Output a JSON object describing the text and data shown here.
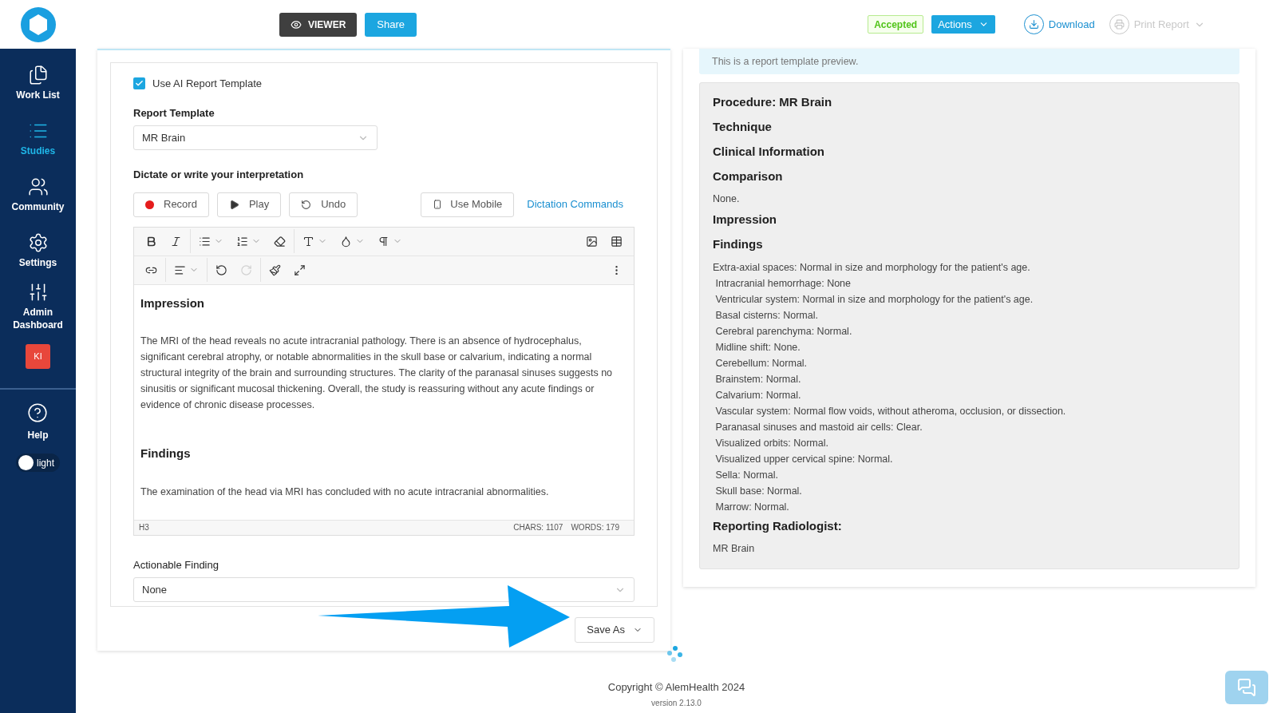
{
  "header": {
    "viewer_button": "VIEWER",
    "share_button": "Share",
    "status_badge": "Accepted",
    "actions_button": "Actions",
    "download": "Download",
    "print_report": {
      "label": "Print Report",
      "disabled": true
    }
  },
  "sidebar": {
    "items": [
      {
        "label": "Work List",
        "selected": false
      },
      {
        "label": "Studies",
        "selected": true
      },
      {
        "label": "Community",
        "selected": false
      },
      {
        "label": "Settings",
        "selected": false
      },
      {
        "label": "Admin Dashboard",
        "selected": false
      }
    ],
    "user_badge": "KI",
    "help": "Help",
    "theme_toggle": {
      "label": "light",
      "on": false
    }
  },
  "editor_panel": {
    "use_ai_template": {
      "label": "Use AI Report Template",
      "checked": true
    },
    "report_template": {
      "label": "Report Template",
      "value": "MR Brain"
    },
    "dictate_heading": "Dictate or write your interpretation",
    "dictation_buttons": [
      {
        "kind": "record",
        "label": "Record"
      },
      {
        "kind": "play",
        "label": "Play"
      },
      {
        "kind": "undo",
        "label": "Undo"
      }
    ],
    "use_mobile": "Use Mobile",
    "dictation_commands": "Dictation Commands",
    "toolbar": [
      [
        {
          "kind": "bold",
          "disabled": false
        },
        {
          "kind": "italic",
          "disabled": false
        },
        {
          "kind": "bullet-list",
          "disabled": false
        },
        {
          "kind": "numbered-list",
          "disabled": false
        },
        {
          "kind": "eraser",
          "disabled": false
        },
        {
          "kind": "text-size",
          "disabled": false
        },
        {
          "kind": "color",
          "disabled": false
        },
        {
          "kind": "paragraph",
          "disabled": false
        },
        {
          "kind": "image",
          "disabled": false
        },
        {
          "kind": "table",
          "disabled": false
        }
      ],
      [
        {
          "kind": "link",
          "disabled": false
        },
        {
          "kind": "align",
          "disabled": false
        },
        {
          "kind": "undo",
          "disabled": false
        },
        {
          "kind": "redo",
          "disabled": true
        },
        {
          "kind": "format-painter",
          "disabled": false
        },
        {
          "kind": "fullscreen",
          "disabled": false
        },
        {
          "kind": "more",
          "disabled": false
        }
      ]
    ],
    "content": [
      {
        "heading": "Impression",
        "body": "The MRI of the head reveals no acute intracranial pathology. There is an absence of hydrocephalus, significant cerebral atrophy, or notable abnormalities in the skull base or calvarium, indicating a normal structural integrity of the brain and surrounding structures. The clarity of the paranasal sinuses suggests no sinusitis or significant mucosal thickening. Overall, the study is reassuring without any acute findings or evidence of chronic disease processes."
      },
      {
        "heading": "Findings",
        "body": "The examination of the head via MRI has concluded with no acute intracranial abnormalities."
      }
    ],
    "status_bar": {
      "block": "H3",
      "chars": "CHARS: 1107",
      "words": "WORDS: 179"
    },
    "actionable_finding": {
      "label": "Actionable Finding",
      "value": "None"
    },
    "save_as": "Save As"
  },
  "preview_panel": {
    "notice": "This is a report template preview.",
    "sections": [
      {
        "kind": "heading",
        "text": "Procedure: MR Brain"
      },
      {
        "kind": "heading",
        "text": "Technique"
      },
      {
        "kind": "heading",
        "text": "Clinical Information"
      },
      {
        "kind": "heading",
        "text": "Comparison"
      },
      {
        "kind": "text",
        "text": "None."
      },
      {
        "kind": "heading",
        "text": "Impression"
      },
      {
        "kind": "heading",
        "text": "Findings"
      },
      {
        "kind": "lines",
        "lines": [
          "Extra-axial spaces: Normal in size and morphology for the patient's age.",
          " Intracranial hemorrhage: None",
          " Ventricular system: Normal in size and morphology for the patient's age.",
          " Basal cisterns: Normal.",
          " Cerebral parenchyma: Normal.",
          " Midline shift: None.",
          " Cerebellum: Normal.",
          " Brainstem: Normal.",
          " Calvarium: Normal.",
          " Vascular system: Normal flow voids, without atheroma, occlusion, or dissection.",
          " Paranasal sinuses and mastoid air cells: Clear.",
          " Visualized orbits: Normal.",
          " Visualized upper cervical spine: Normal.",
          " Sella: Normal.",
          " Skull base: Normal.",
          " Marrow: Normal."
        ]
      },
      {
        "kind": "heading",
        "text": "Reporting Radiologist:"
      },
      {
        "kind": "text",
        "text": "MR Brain"
      }
    ]
  },
  "footer": {
    "copyright": "Copyright © AlemHealth 2024",
    "version": "version 2.13.0"
  }
}
